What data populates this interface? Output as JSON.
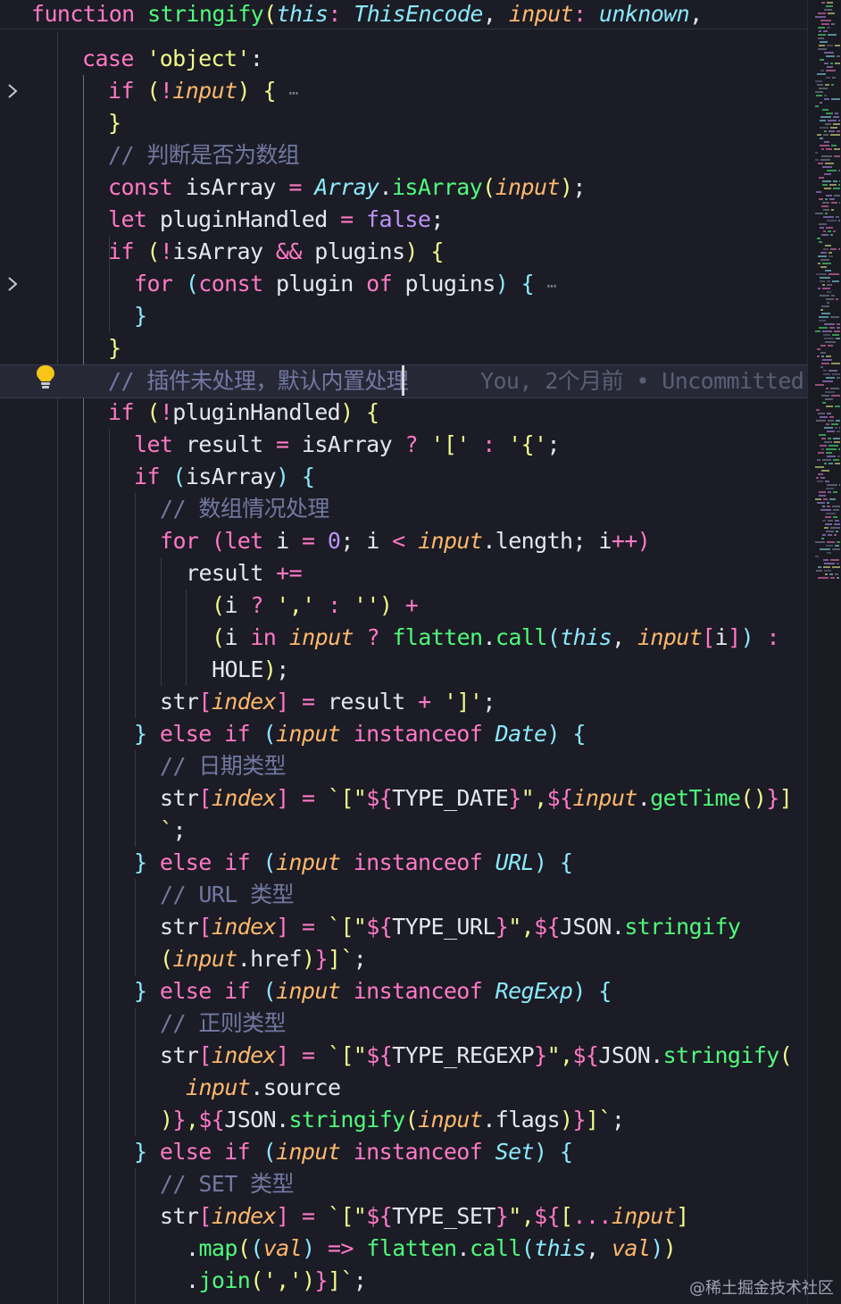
{
  "editor": {
    "blame": "You, 2个月前 • Uncommitted",
    "fold_marker": "⋯",
    "lines": [
      [
        [
          "k",
          "function "
        ],
        [
          "f",
          "stringify"
        ],
        [
          "br1",
          "("
        ],
        [
          "t",
          "this"
        ],
        [
          "k",
          ": "
        ],
        [
          "t",
          "ThisEncode"
        ],
        [
          "pl",
          ", "
        ],
        [
          "p",
          "input"
        ],
        [
          "k",
          ": "
        ],
        [
          "t",
          "unknown"
        ],
        [
          "pl",
          ","
        ]
      ],
      [
        [
          "k",
          "case "
        ],
        [
          "s",
          "'object'"
        ],
        [
          "pl",
          ":"
        ]
      ],
      [
        [
          "k",
          "if "
        ],
        [
          "br1",
          "("
        ],
        [
          "o",
          "!"
        ],
        [
          "p",
          "input"
        ],
        [
          "br1",
          ")"
        ],
        [
          "pl",
          " "
        ],
        [
          "br1",
          "{"
        ]
      ],
      [
        [
          "br1",
          "}"
        ]
      ],
      [
        [
          "c",
          "// 判断是否为数组"
        ]
      ],
      [
        [
          "k",
          "const "
        ],
        [
          "pl",
          "isArray "
        ],
        [
          "o",
          "= "
        ],
        [
          "t",
          "Array"
        ],
        [
          "pl",
          "."
        ],
        [
          "f",
          "isArray"
        ],
        [
          "br1",
          "("
        ],
        [
          "p",
          "input"
        ],
        [
          "br1",
          ")"
        ],
        [
          "pl",
          ";"
        ]
      ],
      [
        [
          "k",
          "let "
        ],
        [
          "pl",
          "pluginHandled "
        ],
        [
          "o",
          "= "
        ],
        [
          "v",
          "false"
        ],
        [
          "pl",
          ";"
        ]
      ],
      [
        [
          "k",
          "if "
        ],
        [
          "br1",
          "("
        ],
        [
          "o",
          "!"
        ],
        [
          "pl",
          "isArray "
        ],
        [
          "o",
          "&& "
        ],
        [
          "pl",
          "plugins"
        ],
        [
          "br1",
          ")"
        ],
        [
          "pl",
          " "
        ],
        [
          "br1",
          "{"
        ]
      ],
      [
        [
          "k",
          "for "
        ],
        [
          "br2",
          "("
        ],
        [
          "k",
          "const "
        ],
        [
          "pl",
          "plugin "
        ],
        [
          "k",
          "of "
        ],
        [
          "pl",
          "plugins"
        ],
        [
          "br2",
          ")"
        ],
        [
          "pl",
          " "
        ],
        [
          "br2",
          "{"
        ]
      ],
      [
        [
          "br2",
          "}"
        ]
      ],
      [
        [
          "br1",
          "}"
        ]
      ],
      [
        [
          "c",
          "// 插件未处理，默认内置处理"
        ]
      ],
      [
        [
          "k",
          "if "
        ],
        [
          "br1",
          "("
        ],
        [
          "o",
          "!"
        ],
        [
          "pl",
          "pluginHandled"
        ],
        [
          "br1",
          ")"
        ],
        [
          "pl",
          " "
        ],
        [
          "br1",
          "{"
        ]
      ],
      [
        [
          "k",
          "let "
        ],
        [
          "pl",
          "result "
        ],
        [
          "o",
          "= "
        ],
        [
          "pl",
          "isArray "
        ],
        [
          "o",
          "? "
        ],
        [
          "s",
          "'[' "
        ],
        [
          "o",
          ": "
        ],
        [
          "s",
          "'{'"
        ],
        [
          "pl",
          ";"
        ]
      ],
      [
        [
          "k",
          "if "
        ],
        [
          "br2",
          "("
        ],
        [
          "pl",
          "isArray"
        ],
        [
          "br2",
          ")"
        ],
        [
          "pl",
          " "
        ],
        [
          "br2",
          "{"
        ]
      ],
      [
        [
          "c",
          "// 数组情况处理"
        ]
      ],
      [
        [
          "k",
          "for "
        ],
        [
          "br3",
          "("
        ],
        [
          "k",
          "let "
        ],
        [
          "pl",
          "i "
        ],
        [
          "o",
          "= "
        ],
        [
          "n",
          "0"
        ],
        [
          "pl",
          "; i "
        ],
        [
          "o",
          "< "
        ],
        [
          "p",
          "input"
        ],
        [
          "pl",
          ".length; i"
        ],
        [
          "o",
          "++"
        ],
        [
          "br3",
          ")"
        ]
      ],
      [
        [
          "pl",
          "result "
        ],
        [
          "o",
          "+="
        ]
      ],
      [
        [
          "br1",
          "("
        ],
        [
          "pl",
          "i "
        ],
        [
          "o",
          "? "
        ],
        [
          "s",
          "',' "
        ],
        [
          "o",
          ": "
        ],
        [
          "s",
          "''"
        ],
        [
          "br1",
          ")"
        ],
        [
          "o",
          " +"
        ]
      ],
      [
        [
          "br1",
          "("
        ],
        [
          "pl",
          "i "
        ],
        [
          "k",
          "in "
        ],
        [
          "p",
          "input "
        ],
        [
          "o",
          "? "
        ],
        [
          "f",
          "flatten"
        ],
        [
          "pl",
          "."
        ],
        [
          "f",
          "call"
        ],
        [
          "br2",
          "("
        ],
        [
          "t",
          "this"
        ],
        [
          "pl",
          ", "
        ],
        [
          "p",
          "input"
        ],
        [
          "br3",
          "["
        ],
        [
          "pl",
          "i"
        ],
        [
          "br3",
          "]"
        ],
        [
          "br2",
          ")"
        ],
        [
          "o",
          " :"
        ]
      ],
      [
        [
          "pl",
          "HOLE"
        ],
        [
          "br1",
          ")"
        ],
        [
          "pl",
          ";"
        ]
      ],
      [
        [
          "pl",
          "str"
        ],
        [
          "br3",
          "["
        ],
        [
          "p",
          "index"
        ],
        [
          "br3",
          "]"
        ],
        [
          "o",
          " = "
        ],
        [
          "pl",
          "result "
        ],
        [
          "o",
          "+ "
        ],
        [
          "s",
          "']'"
        ],
        [
          "pl",
          ";"
        ]
      ],
      [
        [
          "br2",
          "}"
        ],
        [
          "k",
          " else if "
        ],
        [
          "br2",
          "("
        ],
        [
          "p",
          "input "
        ],
        [
          "k",
          "instanceof "
        ],
        [
          "t",
          "Date"
        ],
        [
          "br2",
          ")"
        ],
        [
          "pl",
          " "
        ],
        [
          "br2",
          "{"
        ]
      ],
      [
        [
          "c",
          "// 日期类型"
        ]
      ],
      [
        [
          "pl",
          "str"
        ],
        [
          "br3",
          "["
        ],
        [
          "p",
          "index"
        ],
        [
          "br3",
          "]"
        ],
        [
          "o",
          " = "
        ],
        [
          "s",
          "`[\""
        ],
        [
          "o",
          "${"
        ],
        [
          "pl",
          "TYPE_DATE"
        ],
        [
          "o",
          "}"
        ],
        [
          "s",
          "\","
        ],
        [
          "o",
          "${"
        ],
        [
          "p",
          "input"
        ],
        [
          "pl",
          "."
        ],
        [
          "f",
          "getTime"
        ],
        [
          "br1",
          "()"
        ],
        [
          "o",
          "}"
        ],
        [
          "s",
          "]"
        ]
      ],
      [
        [
          "s",
          "`"
        ],
        [
          "pl",
          ";"
        ]
      ],
      [
        [
          "br2",
          "}"
        ],
        [
          "k",
          " else if "
        ],
        [
          "br2",
          "("
        ],
        [
          "p",
          "input "
        ],
        [
          "k",
          "instanceof "
        ],
        [
          "t",
          "URL"
        ],
        [
          "br2",
          ")"
        ],
        [
          "pl",
          " "
        ],
        [
          "br2",
          "{"
        ]
      ],
      [
        [
          "c",
          "// URL 类型"
        ]
      ],
      [
        [
          "pl",
          "str"
        ],
        [
          "br3",
          "["
        ],
        [
          "p",
          "index"
        ],
        [
          "br3",
          "]"
        ],
        [
          "o",
          " = "
        ],
        [
          "s",
          "`[\""
        ],
        [
          "o",
          "${"
        ],
        [
          "pl",
          "TYPE_URL"
        ],
        [
          "o",
          "}"
        ],
        [
          "s",
          "\","
        ],
        [
          "o",
          "${"
        ],
        [
          "pl",
          "JSON"
        ],
        [
          "pl",
          "."
        ],
        [
          "f",
          "stringify"
        ]
      ],
      [
        [
          "br1",
          "("
        ],
        [
          "p",
          "input"
        ],
        [
          "pl",
          ".href"
        ],
        [
          "br1",
          ")"
        ],
        [
          "o",
          "}"
        ],
        [
          "s",
          "]`"
        ],
        [
          "pl",
          ";"
        ]
      ],
      [
        [
          "br2",
          "}"
        ],
        [
          "k",
          " else if "
        ],
        [
          "br2",
          "("
        ],
        [
          "p",
          "input "
        ],
        [
          "k",
          "instanceof "
        ],
        [
          "t",
          "RegExp"
        ],
        [
          "br2",
          ")"
        ],
        [
          "pl",
          " "
        ],
        [
          "br2",
          "{"
        ]
      ],
      [
        [
          "c",
          "// 正则类型"
        ]
      ],
      [
        [
          "pl",
          "str"
        ],
        [
          "br3",
          "["
        ],
        [
          "p",
          "index"
        ],
        [
          "br3",
          "]"
        ],
        [
          "o",
          " = "
        ],
        [
          "s",
          "`[\""
        ],
        [
          "o",
          "${"
        ],
        [
          "pl",
          "TYPE_REGEXP"
        ],
        [
          "o",
          "}"
        ],
        [
          "s",
          "\","
        ],
        [
          "o",
          "${"
        ],
        [
          "pl",
          "JSON"
        ],
        [
          "pl",
          "."
        ],
        [
          "f",
          "stringify"
        ],
        [
          "br1",
          "("
        ]
      ],
      [
        [
          "p",
          "input"
        ],
        [
          "pl",
          ".source"
        ]
      ],
      [
        [
          "br1",
          ")"
        ],
        [
          "o",
          "}"
        ],
        [
          "s",
          ","
        ],
        [
          "o",
          "${"
        ],
        [
          "pl",
          "JSON"
        ],
        [
          "pl",
          "."
        ],
        [
          "f",
          "stringify"
        ],
        [
          "br1",
          "("
        ],
        [
          "p",
          "input"
        ],
        [
          "pl",
          ".flags"
        ],
        [
          "br1",
          ")"
        ],
        [
          "o",
          "}"
        ],
        [
          "s",
          "]`"
        ],
        [
          "pl",
          ";"
        ]
      ],
      [
        [
          "br2",
          "}"
        ],
        [
          "k",
          " else if "
        ],
        [
          "br2",
          "("
        ],
        [
          "p",
          "input "
        ],
        [
          "k",
          "instanceof "
        ],
        [
          "t",
          "Set"
        ],
        [
          "br2",
          ")"
        ],
        [
          "pl",
          " "
        ],
        [
          "br2",
          "{"
        ]
      ],
      [
        [
          "c",
          "// SET 类型"
        ]
      ],
      [
        [
          "pl",
          "str"
        ],
        [
          "br3",
          "["
        ],
        [
          "p",
          "index"
        ],
        [
          "br3",
          "]"
        ],
        [
          "o",
          " = "
        ],
        [
          "s",
          "`[\""
        ],
        [
          "o",
          "${"
        ],
        [
          "pl",
          "TYPE_SET"
        ],
        [
          "o",
          "}"
        ],
        [
          "s",
          "\","
        ],
        [
          "o",
          "${"
        ],
        [
          "br1",
          "["
        ],
        [
          "o",
          "..."
        ],
        [
          "p",
          "input"
        ],
        [
          "br1",
          "]"
        ]
      ],
      [
        [
          "pl",
          "."
        ],
        [
          "f",
          "map"
        ],
        [
          "br1",
          "("
        ],
        [
          "br2",
          "("
        ],
        [
          "p",
          "val"
        ],
        [
          "br2",
          ")"
        ],
        [
          "o",
          " => "
        ],
        [
          "f",
          "flatten"
        ],
        [
          "pl",
          "."
        ],
        [
          "f",
          "call"
        ],
        [
          "br2",
          "("
        ],
        [
          "t",
          "this"
        ],
        [
          "pl",
          ", "
        ],
        [
          "p",
          "val"
        ],
        [
          "br2",
          ")"
        ],
        [
          "br1",
          ")"
        ]
      ],
      [
        [
          "pl",
          "."
        ],
        [
          "f",
          "join"
        ],
        [
          "br1",
          "("
        ],
        [
          "s",
          "','"
        ],
        [
          "br1",
          ")"
        ],
        [
          "o",
          "}"
        ],
        [
          "s",
          "]`"
        ],
        [
          "pl",
          ";"
        ]
      ]
    ]
  },
  "colors": {
    "background": "#1b1c25",
    "keyword": "#ff79c6",
    "string": "#f1fa8c",
    "comment": "#7278a0",
    "function": "#50fa7b",
    "type": "#8be9fd",
    "parameter": "#ffb86c",
    "constant": "#bd93f9",
    "plain": "#e5e7ef"
  },
  "watermark": "@稀土掘金技术社区"
}
